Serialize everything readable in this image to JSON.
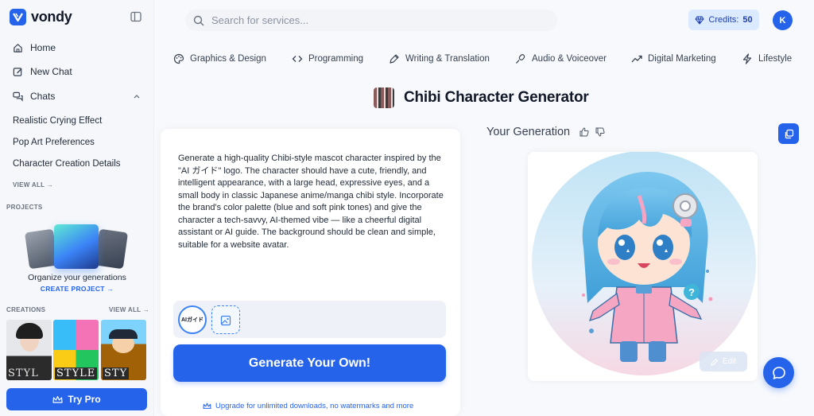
{
  "app": {
    "name": "vondy"
  },
  "sidebar": {
    "nav": [
      {
        "label": "Home",
        "icon": "home-icon"
      },
      {
        "label": "New Chat",
        "icon": "edit-icon"
      },
      {
        "label": "Chats",
        "icon": "chats-icon"
      }
    ],
    "chats": [
      "Realistic Crying Effect",
      "Pop Art Preferences",
      "Character Creation Details"
    ],
    "view_all_chats": "VIEW ALL →",
    "projects_label": "PROJECTS",
    "projects_text": "Organize your generations",
    "create_project": "CREATE PROJECT →",
    "creations_label": "CREATIONS",
    "creations_view_all": "VIEW ALL →",
    "try_pro": "Try Pro"
  },
  "header": {
    "search_placeholder": "Search for services...",
    "credits_label": "Credits:",
    "credits_value": "50",
    "avatar_initial": "K"
  },
  "categories": [
    {
      "label": "Graphics & Design",
      "icon": "palette-icon"
    },
    {
      "label": "Programming",
      "icon": "code-icon"
    },
    {
      "label": "Writing & Translation",
      "icon": "pen-icon"
    },
    {
      "label": "Audio & Voiceover",
      "icon": "microphone-icon"
    },
    {
      "label": "Digital Marketing",
      "icon": "trending-icon"
    },
    {
      "label": "Lifestyle",
      "icon": "lightning-icon"
    }
  ],
  "tool": {
    "title": "Chibi Character Generator",
    "prompt": "Generate a high-quality Chibi-style mascot character inspired by the \"AI ガイド\" logo. The character should have a cute, friendly, and intelligent appearance, with a large head, expressive eyes, and a small body in classic Japanese anime/manga chibi style. Incorporate the brand's color palette (blue and soft pink tones) and give the character a tech-savvy, AI-themed vibe — like a cheerful digital assistant or AI guide. The background should be clean and simple, suitable for a website avatar.",
    "upload_logo_text": "AIガイド",
    "generate_button": "Generate Your Own!",
    "upgrade_text": "Upgrade for unlimited downloads, no watermarks and more"
  },
  "generation": {
    "title": "Your Generation",
    "edit_button": "Edit"
  },
  "colors": {
    "accent": "#2563eb",
    "credits_bg": "#dbeafe"
  }
}
